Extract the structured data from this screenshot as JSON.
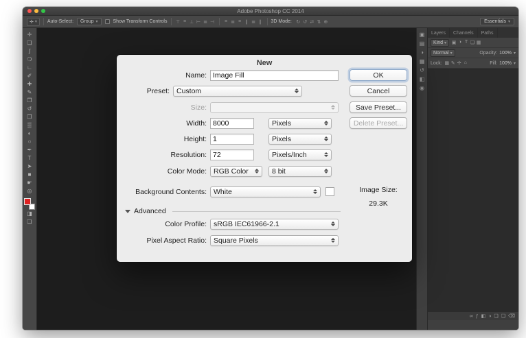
{
  "window": {
    "title": "Adobe Photoshop CC 2014"
  },
  "options_bar": {
    "tool_icon": {
      "name": "move-tool-icon",
      "glyph": "✛"
    },
    "auto_select_label": "Auto-Select:",
    "auto_select_value": "Group",
    "show_transform_label": "Show Transform Controls",
    "mode_label": "3D Mode:",
    "workspace_value": "Essentials",
    "align_icons": [
      {
        "name": "align-top-edges-icon",
        "glyph": "⊤"
      },
      {
        "name": "align-vertical-centers-icon",
        "glyph": "≡"
      },
      {
        "name": "align-bottom-edges-icon",
        "glyph": "⊥"
      },
      {
        "name": "align-left-edges-icon",
        "glyph": "⊢"
      },
      {
        "name": "align-horizontal-centers-icon",
        "glyph": "≣"
      },
      {
        "name": "align-right-edges-icon",
        "glyph": "⊣"
      }
    ],
    "distribute_icons": [
      {
        "name": "distribute-top-edges-icon",
        "glyph": "≡"
      },
      {
        "name": "distribute-vertical-centers-icon",
        "glyph": "≣"
      },
      {
        "name": "distribute-bottom-edges-icon",
        "glyph": "≡"
      },
      {
        "name": "distribute-left-edges-icon",
        "glyph": "∥"
      },
      {
        "name": "distribute-horizontal-centers-icon",
        "glyph": "≣"
      },
      {
        "name": "distribute-right-edges-icon",
        "glyph": "∥"
      }
    ],
    "mode_icons": [
      {
        "name": "3d-rotate-icon",
        "glyph": "↻"
      },
      {
        "name": "3d-roll-icon",
        "glyph": "↺"
      },
      {
        "name": "3d-drag-icon",
        "glyph": "⇄"
      },
      {
        "name": "3d-slide-icon",
        "glyph": "⇅"
      },
      {
        "name": "3d-scale-icon",
        "glyph": "⊕"
      }
    ]
  },
  "toolbar": {
    "foreground_color": "#e02222",
    "background_color": "#ffffff",
    "tools": [
      {
        "name": "move-tool",
        "glyph": "✛"
      },
      {
        "name": "rectangular-marquee-tool",
        "glyph": "❏"
      },
      {
        "name": "lasso-tool",
        "glyph": "ʃ"
      },
      {
        "name": "quick-selection-tool",
        "glyph": "❍"
      },
      {
        "name": "crop-tool",
        "glyph": "∟"
      },
      {
        "name": "eyedropper-tool",
        "glyph": "✐"
      },
      {
        "name": "spot-healing-brush-tool",
        "glyph": "✚"
      },
      {
        "name": "brush-tool",
        "glyph": "✎"
      },
      {
        "name": "clone-stamp-tool",
        "glyph": "❐"
      },
      {
        "name": "history-brush-tool",
        "glyph": "↺"
      },
      {
        "name": "eraser-tool",
        "glyph": "❒"
      },
      {
        "name": "gradient-tool",
        "glyph": "▒"
      },
      {
        "name": "blur-tool",
        "glyph": "◐"
      },
      {
        "name": "dodge-tool",
        "glyph": "○"
      },
      {
        "name": "pen-tool",
        "glyph": "✒"
      },
      {
        "name": "horizontal-type-tool",
        "glyph": "T"
      },
      {
        "name": "path-selection-tool",
        "glyph": "➤"
      },
      {
        "name": "rectangle-tool",
        "glyph": "■"
      },
      {
        "name": "hand-tool",
        "glyph": "☛"
      },
      {
        "name": "zoom-tool",
        "glyph": "◎"
      }
    ],
    "extra_tools": [
      {
        "name": "quick-mask-mode-button",
        "glyph": "◨"
      },
      {
        "name": "screen-mode-button",
        "glyph": "❏"
      }
    ]
  },
  "dock_strip": {
    "icons": [
      {
        "name": "color-panel-icon",
        "glyph": "▣"
      },
      {
        "name": "swatches-panel-icon",
        "glyph": "▤"
      },
      {
        "name": "adjustments-panel-icon",
        "glyph": "◑"
      },
      {
        "name": "styles-panel-icon",
        "glyph": "▦"
      },
      {
        "name": "history-panel-icon",
        "glyph": "↺"
      },
      {
        "name": "properties-panel-icon",
        "glyph": "◧"
      },
      {
        "name": "info-panel-icon",
        "glyph": "◉"
      }
    ]
  },
  "layers_panel": {
    "tabs": [
      "Layers",
      "Channels",
      "Paths"
    ],
    "filter_label": "Kind",
    "filter_icons": [
      {
        "name": "pixel-layer-filter-icon",
        "glyph": "▣"
      },
      {
        "name": "adjustment-layer-filter-icon",
        "glyph": "◑"
      },
      {
        "name": "type-layer-filter-icon",
        "glyph": "T"
      },
      {
        "name": "shape-layer-filter-icon",
        "glyph": "❏"
      },
      {
        "name": "smart-object-filter-icon",
        "glyph": "▦"
      }
    ],
    "blend_mode_value": "Normal",
    "opacity_label": "Opacity:",
    "opacity_value": "100%",
    "lock_label": "Lock:",
    "lock_icons": [
      {
        "name": "lock-transparency-icon",
        "glyph": "▦"
      },
      {
        "name": "lock-pixels-icon",
        "glyph": "✎"
      },
      {
        "name": "lock-position-icon",
        "glyph": "✢"
      },
      {
        "name": "lock-all-icon",
        "glyph": "⌂"
      }
    ],
    "fill_label": "Fill:",
    "fill_value": "100%",
    "bottom_icons": [
      {
        "name": "link-layers-icon",
        "glyph": "∞"
      },
      {
        "name": "layer-style-icon",
        "glyph": "ƒ"
      },
      {
        "name": "add-layer-mask-icon",
        "glyph": "◧"
      },
      {
        "name": "adjustment-layer-icon",
        "glyph": "◑"
      },
      {
        "name": "new-group-icon",
        "glyph": "❏"
      },
      {
        "name": "new-layer-icon",
        "glyph": "❑"
      },
      {
        "name": "delete-layer-icon",
        "glyph": "⌫"
      }
    ]
  },
  "dialog": {
    "title": "New",
    "name_label": "Name:",
    "name_value": "Image Fill",
    "preset_label": "Preset:",
    "preset_value": "Custom",
    "size_label": "Size:",
    "size_value": "",
    "width_label": "Width:",
    "width_value": "8000",
    "width_unit": "Pixels",
    "height_label": "Height:",
    "height_value": "1",
    "height_unit": "Pixels",
    "resolution_label": "Resolution:",
    "resolution_value": "72",
    "resolution_unit": "Pixels/Inch",
    "color_mode_label": "Color Mode:",
    "color_mode_value": "RGB Color",
    "bit_depth_value": "8 bit",
    "background_label": "Background Contents:",
    "background_value": "White",
    "background_swatch_color": "#ffffff",
    "advanced_label": "Advanced",
    "color_profile_label": "Color Profile:",
    "color_profile_value": "sRGB IEC61966-2.1",
    "pixel_aspect_label": "Pixel Aspect Ratio:",
    "pixel_aspect_value": "Square Pixels",
    "image_size_label": "Image Size:",
    "image_size_value": "29.3K",
    "buttons": {
      "ok": "OK",
      "cancel": "Cancel",
      "save_preset": "Save Preset...",
      "delete_preset": "Delete Preset..."
    }
  }
}
